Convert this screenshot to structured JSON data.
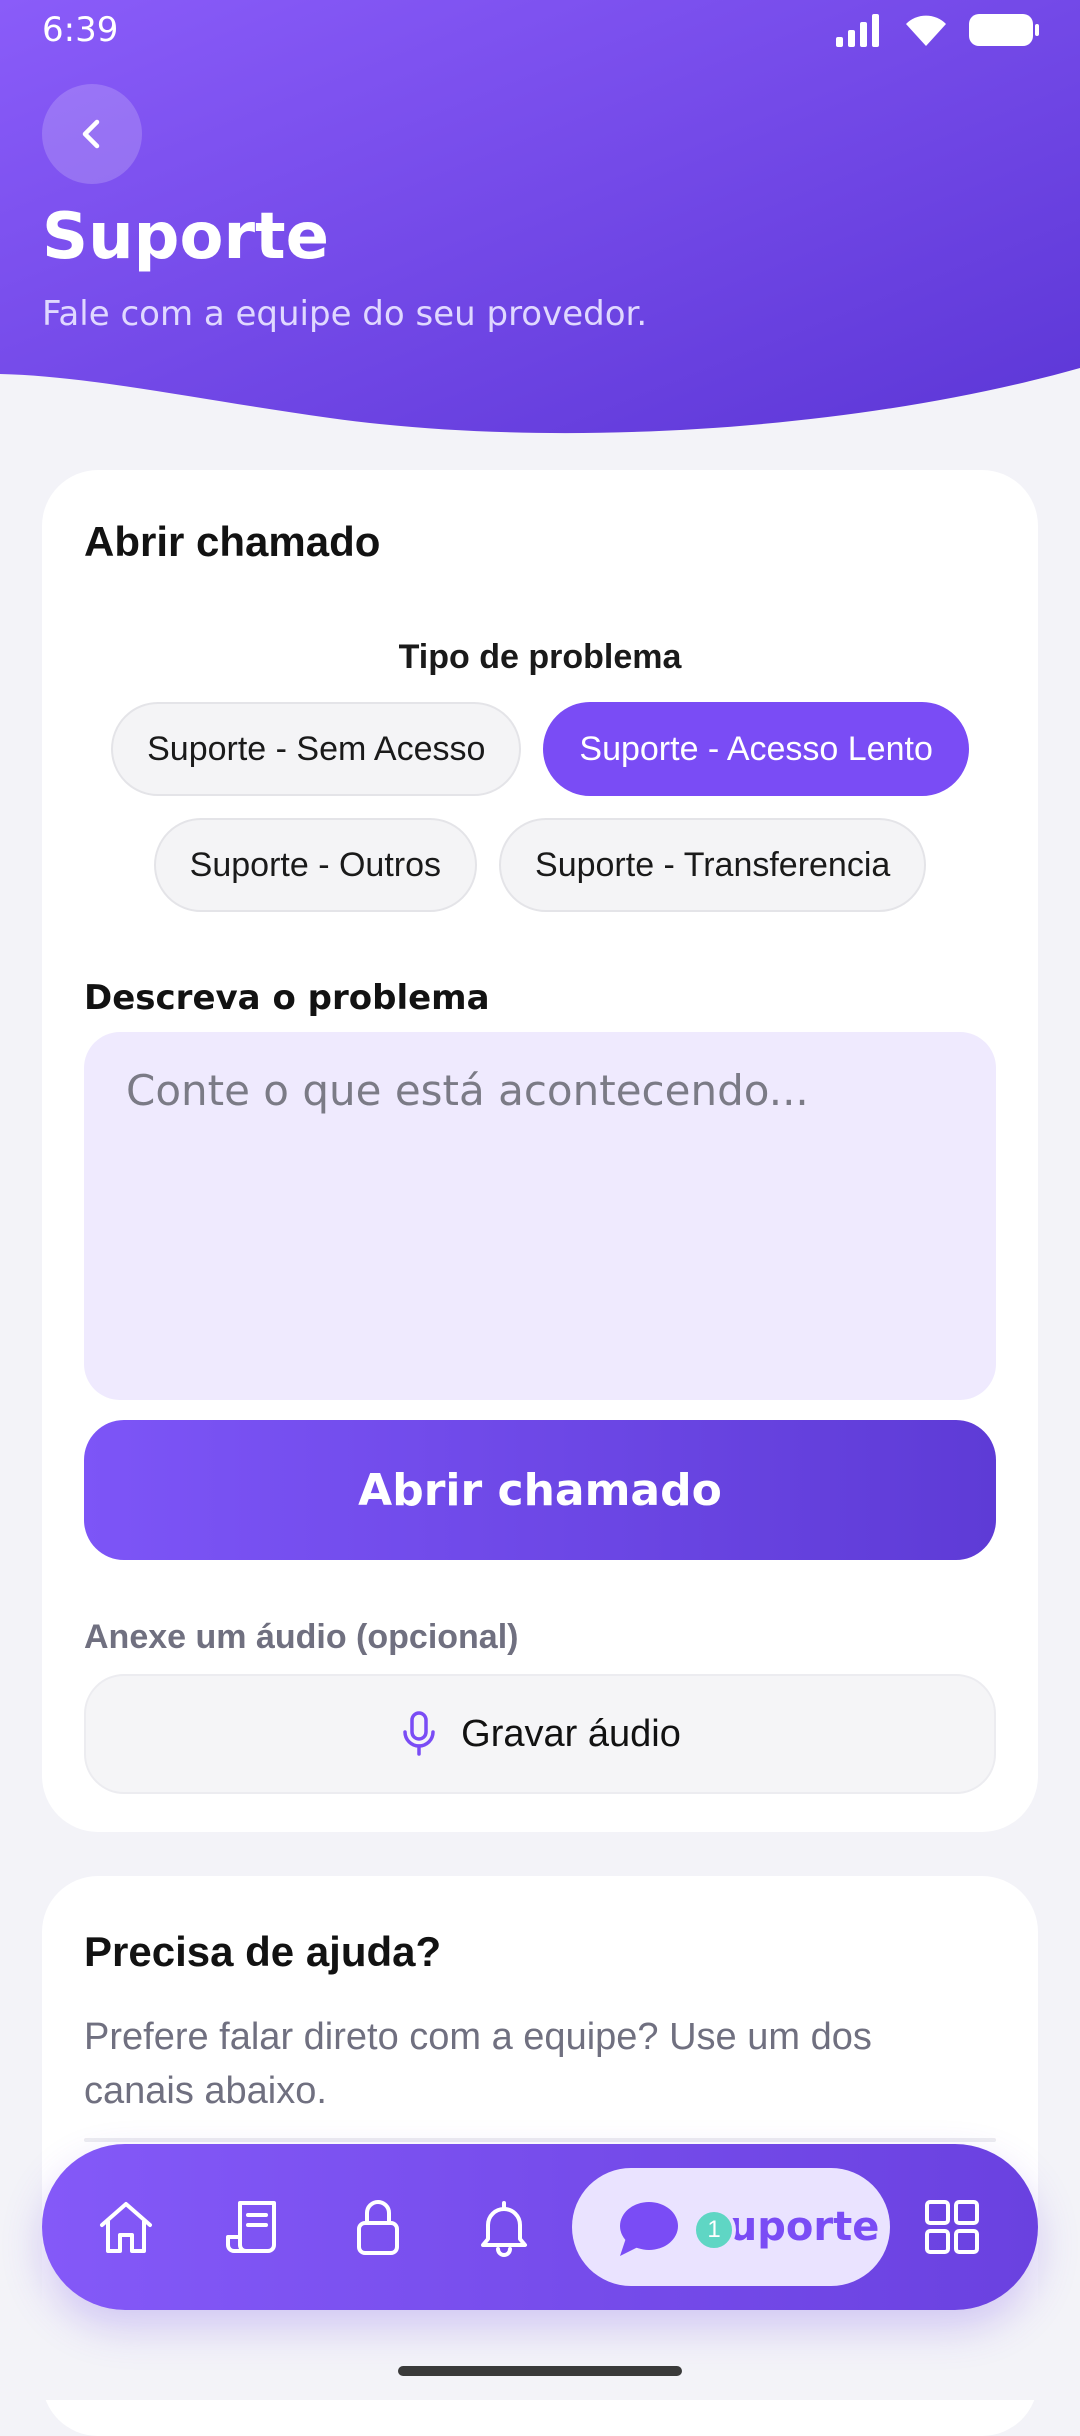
{
  "status_bar": {
    "time": "6:39"
  },
  "header": {
    "title": "Suporte",
    "subtitle": "Fale com a equipe do seu provedor."
  },
  "ticket": {
    "card_title": "Abrir chamado",
    "problem_type_label": "Tipo de problema",
    "problem_types": [
      {
        "label": "Suporte - Sem Acesso",
        "selected": false
      },
      {
        "label": "Suporte - Acesso Lento",
        "selected": true
      },
      {
        "label": "Suporte - Outros",
        "selected": false
      },
      {
        "label": "Suporte - Transferencia",
        "selected": false
      }
    ],
    "description_label": "Descreva o problema",
    "description_value": "",
    "description_placeholder": "Conte o que está acontecendo...",
    "submit_label": "Abrir chamado",
    "audio_label": "Anexe um áudio (opcional)",
    "audio_button_label": "Gravar áudio"
  },
  "help": {
    "title": "Precisa de ajuda?",
    "text": "Prefere falar direto com a equipe? Use um dos canais abaixo."
  },
  "bottom_nav": {
    "items": [
      {
        "icon": "home-icon"
      },
      {
        "icon": "invoice-icon"
      },
      {
        "icon": "lock-icon"
      },
      {
        "icon": "bell-icon"
      },
      {
        "icon": "chat-icon",
        "label": "Suporte",
        "active": true,
        "badge": "1"
      },
      {
        "icon": "grid-icon"
      }
    ]
  },
  "colors": {
    "primary": "#7a4cf5",
    "primary_dark": "#5e3bd6",
    "badge": "#5fd6c4",
    "input_bg": "#efeafe",
    "page_bg": "#f3f3f8"
  }
}
